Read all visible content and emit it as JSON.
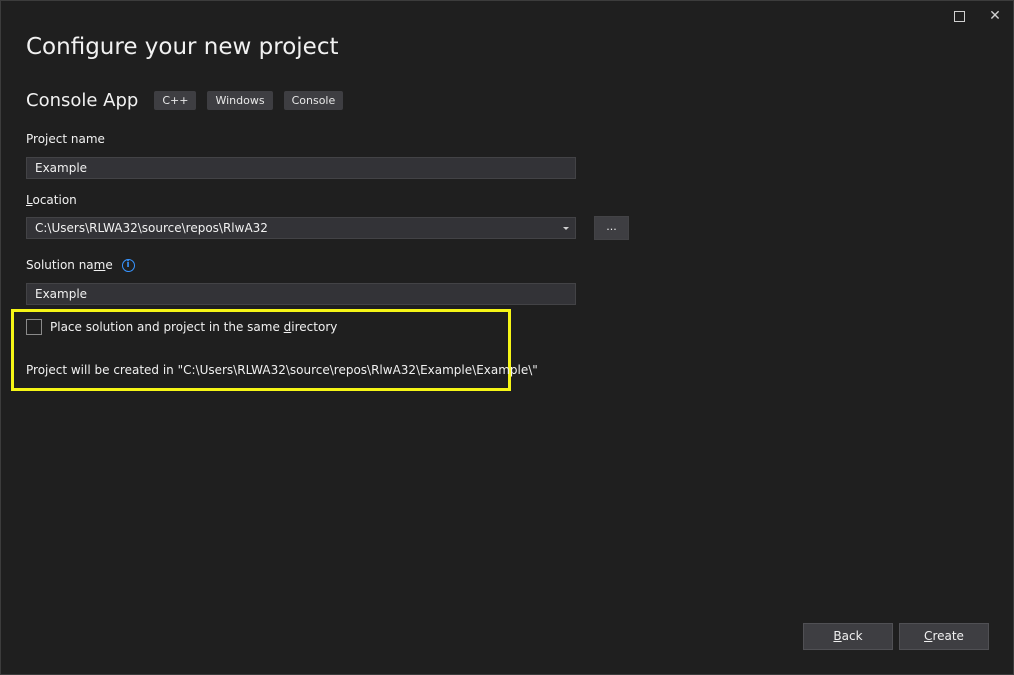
{
  "window": {
    "title": "Configure your new project",
    "controls": {
      "maximize_icon": "maximize-icon",
      "close_glyph": "✕"
    }
  },
  "template": {
    "name": "Console App",
    "tags": [
      "C++",
      "Windows",
      "Console"
    ]
  },
  "fields": {
    "project_name": {
      "label": "Project name",
      "value": "Example"
    },
    "location": {
      "label_pre": "",
      "label_ul": "L",
      "label_post": "ocation",
      "value": "C:\\Users\\RLWA32\\source\\repos\\RlwA32"
    },
    "browse_label": "...",
    "solution_name": {
      "label_pre": "Solution na",
      "label_ul": "m",
      "label_post": "e",
      "value": "Example",
      "info_icon": "i"
    }
  },
  "options": {
    "same_dir_pre": "Place solution and project in the same ",
    "same_dir_ul": "d",
    "same_dir_post": "irectory",
    "created_in": "Project will be created in \"C:\\Users\\RLWA32\\source\\repos\\RlwA32\\Example\\Example\\\""
  },
  "buttons": {
    "back_ul": "B",
    "back_rest": "ack",
    "create_ul": "C",
    "create_rest": "reate"
  },
  "colors": {
    "background": "#1f1f1f",
    "highlight": "#f5f516",
    "info": "#3794ff"
  }
}
